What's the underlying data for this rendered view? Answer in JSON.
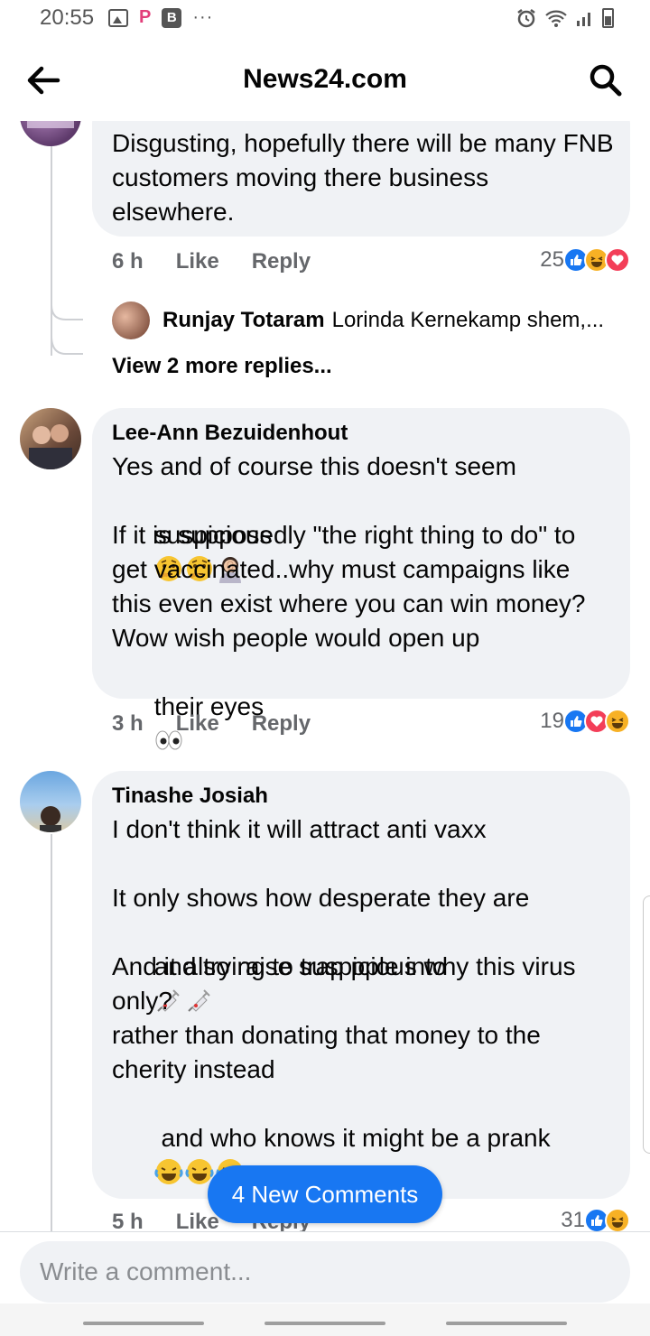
{
  "status_bar": {
    "time": "20:55"
  },
  "header": {
    "title": "News24.com"
  },
  "comments": [
    {
      "text": "Disgusting, hopefully there will be many FNB customers moving there business elsewhere.",
      "time": "6 h",
      "like_label": "Like",
      "reply_label": "Reply",
      "reaction_count": "25",
      "reactions": [
        "like",
        "haha",
        "love"
      ],
      "reply_preview": {
        "name": "Runjay Totaram",
        "snippet": "Lorinda Kernekamp shem,..."
      },
      "view_more": "View 2 more replies..."
    },
    {
      "author": "Lee-Ann Bezuidenhout",
      "line1": "Yes and of course this doesn't seem",
      "line2": "suspicious",
      "line2_emoji": [
        "thinking-face",
        "thinking-face",
        "woman-facepalming"
      ],
      "rest": "If it is supposedly \"the right thing to do\" to get vaccinated..why must campaigns like this even exist where you can win money? Wow wish people would open up",
      "last": "their eyes",
      "last_emoji": [
        "eyes"
      ],
      "time": "3 h",
      "like_label": "Like",
      "reply_label": "Reply",
      "reaction_count": "19",
      "reactions": [
        "like",
        "love",
        "haha"
      ]
    },
    {
      "author": "Tinashe Josiah",
      "p1": "I don't think it will attract anti vaxx",
      "p2a": "It only shows how desperate they are",
      "p2b": "and trying to trap pple into",
      "p2b_emoji": [
        "syringe",
        "syringe"
      ],
      "p3": "And it also raise suspicious why this virus only?\nrather than donating that money to the cherity instead",
      "p4": " and who knows it might be a prank",
      "p4_emoji": [
        "face-with-tears-of-joy",
        "face-with-tears-of-joy",
        "face-with-tears-of-joy",
        "face-with-tears-of-joy"
      ],
      "time": "5 h",
      "like_label": "Like",
      "reply_label": "Reply",
      "reaction_count": "31",
      "reactions": [
        "like",
        "haha"
      ]
    }
  ],
  "new_comments_pill": "4 New Comments",
  "composer": {
    "placeholder": "Write a comment..."
  },
  "colors": {
    "accent": "#1877f2",
    "bubble": "#f0f2f5",
    "love": "#f33e58",
    "haha": "#f7b125"
  }
}
